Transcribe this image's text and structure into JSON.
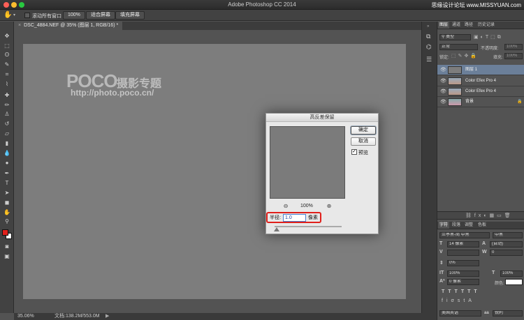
{
  "app": {
    "title": "Adobe Photoshop CC 2014",
    "watermark": "思缘设计论坛 www.MISSYUAN.com"
  },
  "options_bar": {
    "scroll_all_label": "滚动所有窗口",
    "btn_100": "100%",
    "btn_fit": "适合屏幕",
    "btn_fill": "填充屏幕"
  },
  "document": {
    "tab_label": "DSC_4884.NEF @ 35% (图层 1, RGB/16) *"
  },
  "canvas": {
    "logo_text": "POCO",
    "logo_title": "摄影专题",
    "logo_url": "http://photo.poco.cn/"
  },
  "dialog": {
    "title": "高反差保留",
    "ok_label": "确定",
    "cancel_label": "取消",
    "preview_label": "预览",
    "preview_checked": true,
    "zoom_level": "100%",
    "radius_label": "半径:",
    "radius_value": "1.0",
    "unit_label": "像素"
  },
  "status": {
    "zoom": "35.06%",
    "doc_info": "文档:138.2M/553.0M"
  },
  "layers_panel": {
    "tabs": [
      "图层",
      "通道",
      "路径",
      "历史记录"
    ],
    "filter_kind": "类型",
    "blend_mode": "正常",
    "opacity_label": "不透明度:",
    "opacity_value": "100%",
    "lock_label": "锁定:",
    "fill_label": "填充:",
    "fill_value": "100%",
    "layers": [
      {
        "name": "图层 1",
        "selected": true
      },
      {
        "name": "Color Efex Pro 4",
        "selected": false
      },
      {
        "name": "Color Efex Pro 4",
        "selected": false
      },
      {
        "name": "背景",
        "selected": false
      }
    ]
  },
  "char_panel": {
    "tabs": [
      "字符",
      "段落",
      "调整",
      "色板"
    ],
    "font_family": "兰亭黑-简 中黑",
    "font_style": "中黑",
    "font_size": "14 像素",
    "leading": "(自动)",
    "tracking": "0",
    "kerning": "0%",
    "vscale": "100%",
    "hscale": "100%",
    "baseline": "0 像素",
    "color_label": "颜色:",
    "language": "美国英语",
    "antialias": "锐利"
  },
  "colors": {
    "highlight_box": "#e0201b",
    "foreground_swatch": "#e0201b",
    "background_swatch": "#ffffff",
    "selected_layer": "#6b7f99"
  }
}
